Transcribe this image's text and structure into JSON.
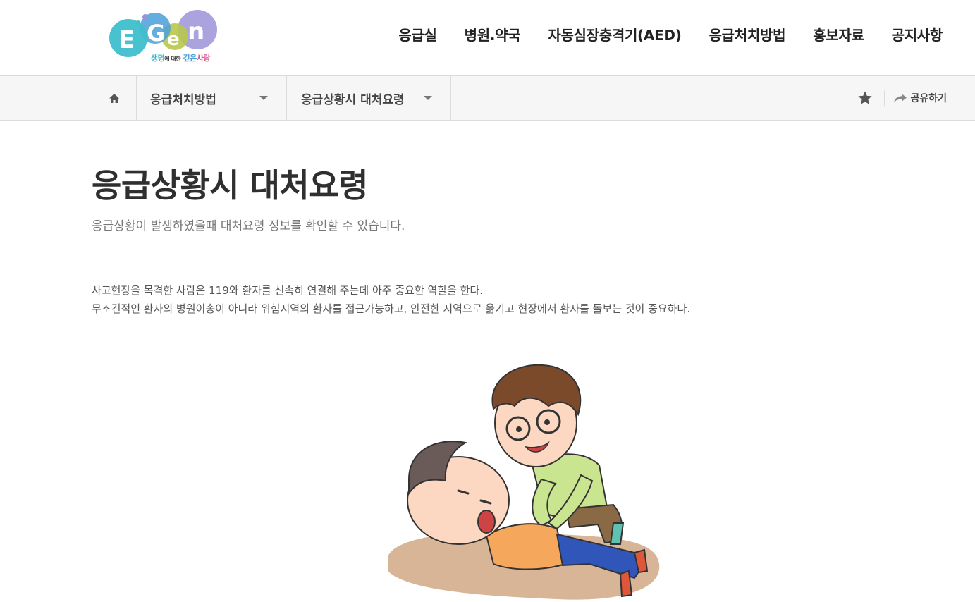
{
  "logo": {
    "letters": [
      "E",
      "G",
      "e",
      "n"
    ],
    "tagline_part1": "생명",
    "tagline_part2": "에 대한",
    "tagline_part3": "깊은",
    "tagline_part4": "사랑",
    "colors": {
      "teal": "#3fbfcc",
      "lime": "#b8c84a",
      "blue": "#4a9fd8",
      "lavender": "#9b93d8",
      "pink": "#d94f8c"
    }
  },
  "gnb": {
    "items": [
      {
        "label": "응급실"
      },
      {
        "label": "병원.약국"
      },
      {
        "label": "자동심장충격기(AED)"
      },
      {
        "label": "응급처치방법"
      },
      {
        "label": "홍보자료"
      },
      {
        "label": "공지사항"
      }
    ]
  },
  "location": {
    "home_icon": "home-icon",
    "depth1": "응급처치방법",
    "depth2": "응급상황시 대처요령",
    "bookmark_icon": "star-icon",
    "share_label": "공유하기",
    "share_icon": "share-arrow-icon"
  },
  "page": {
    "title": "응급상황시 대처요령",
    "description": "응급상황이 발생하였을때 대처요령 정보를 확인할 수 있습니다.",
    "paragraph_line1": "사고현장을 목격한 사람은 119와 환자를 신속히 연결해 주는데 아주 중요한 역할을 한다.",
    "paragraph_line2": "무조건적인 환자의 병원이송이 아니라 위험지역의 환자를 접근가능하고, 안전한 지역으로 옮기고 현장에서 환자를 돌보는 것이 중요하다."
  }
}
